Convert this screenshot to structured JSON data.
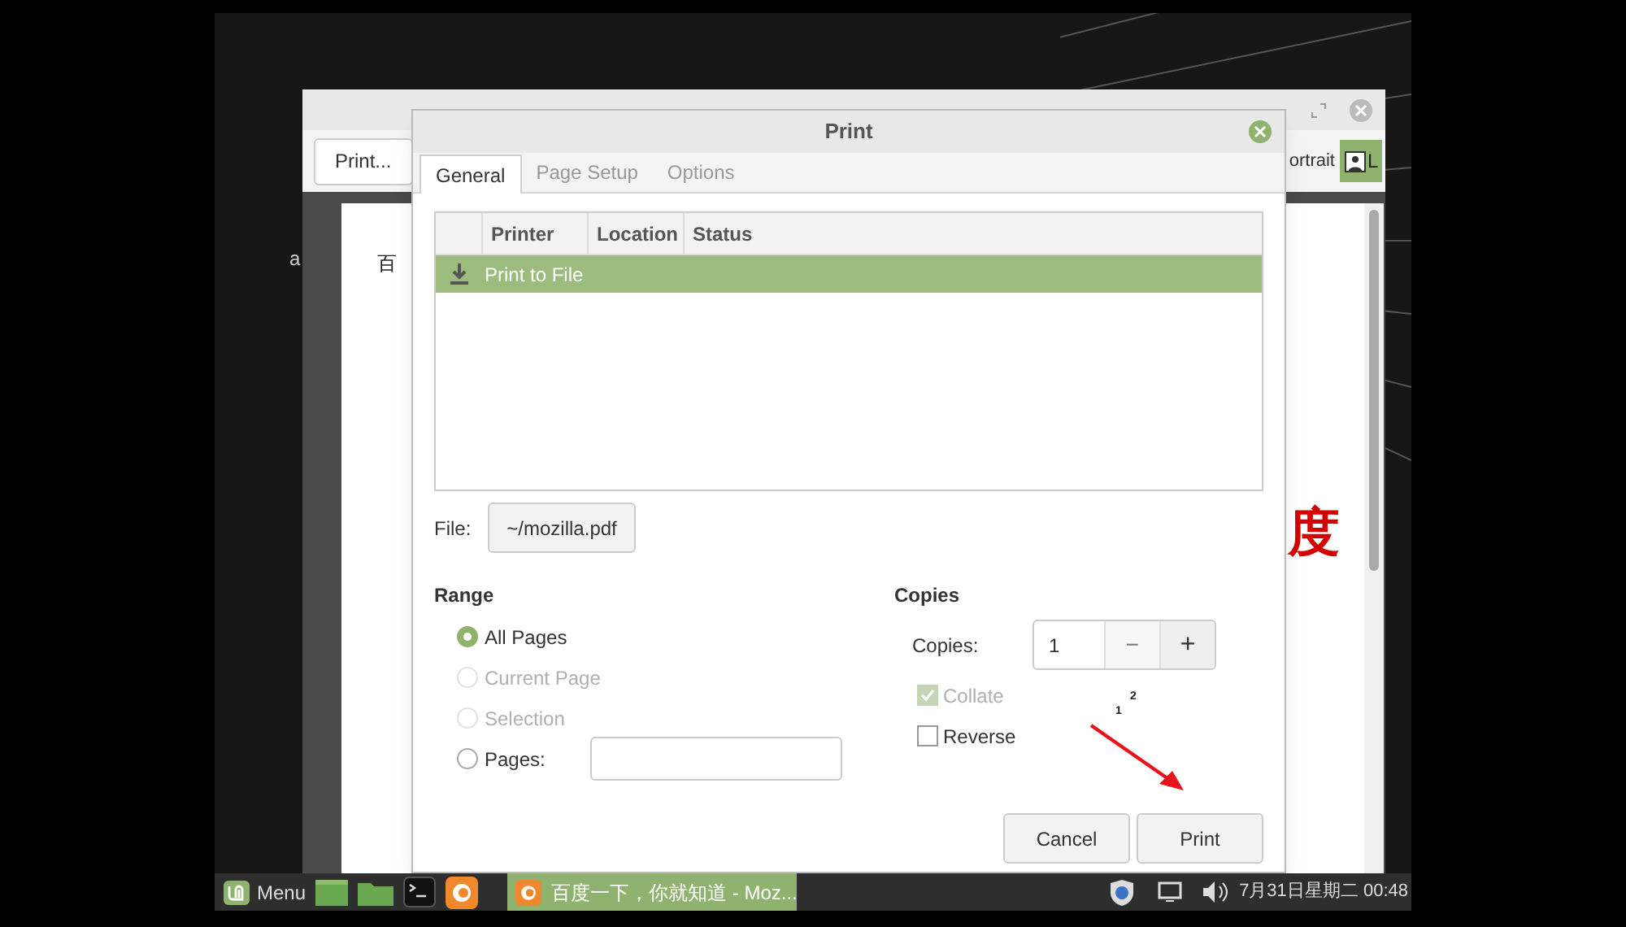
{
  "firefox": {
    "toolbar": {
      "print_button": "Print...",
      "orientation_label": "ortrait",
      "landscape_button": "L"
    },
    "page": {
      "side_text": "a",
      "heading": "百",
      "big_text": "度"
    }
  },
  "dialog": {
    "title": "Print",
    "tabs": [
      {
        "label": "General",
        "selected": true
      },
      {
        "label": "Page Setup",
        "selected": false
      },
      {
        "label": "Options",
        "selected": false
      }
    ],
    "printer_table": {
      "columns": [
        "Printer",
        "Location",
        "Status"
      ],
      "rows": [
        {
          "name": "Print to File",
          "selected": true
        }
      ]
    },
    "file": {
      "label": "File:",
      "value": "~/mozilla.pdf"
    },
    "range": {
      "heading": "Range",
      "options": [
        {
          "label": "All Pages",
          "selected": true,
          "disabled": false
        },
        {
          "label": "Current Page",
          "selected": false,
          "disabled": true
        },
        {
          "label": "Selection",
          "selected": false,
          "disabled": true
        },
        {
          "label": "Pages:",
          "selected": false,
          "disabled": false,
          "kind": "field"
        }
      ]
    },
    "copies": {
      "heading": "Copies",
      "label": "Copies:",
      "value": "1",
      "decrement": "−",
      "increment": "+",
      "collate": {
        "label": "Collate",
        "checked": true,
        "disabled": true
      },
      "reverse": {
        "label": "Reverse",
        "checked": false,
        "disabled": false
      }
    },
    "markers": [
      "1",
      "2"
    ],
    "buttons": [
      {
        "label": "Cancel"
      },
      {
        "label": "Print"
      }
    ]
  },
  "taskbar": {
    "menu_label": "Menu",
    "window_button": {
      "label": "百度一下，你就知道 - Moz...",
      "selected": true
    },
    "clock": "7月31日星期二 00:48"
  }
}
